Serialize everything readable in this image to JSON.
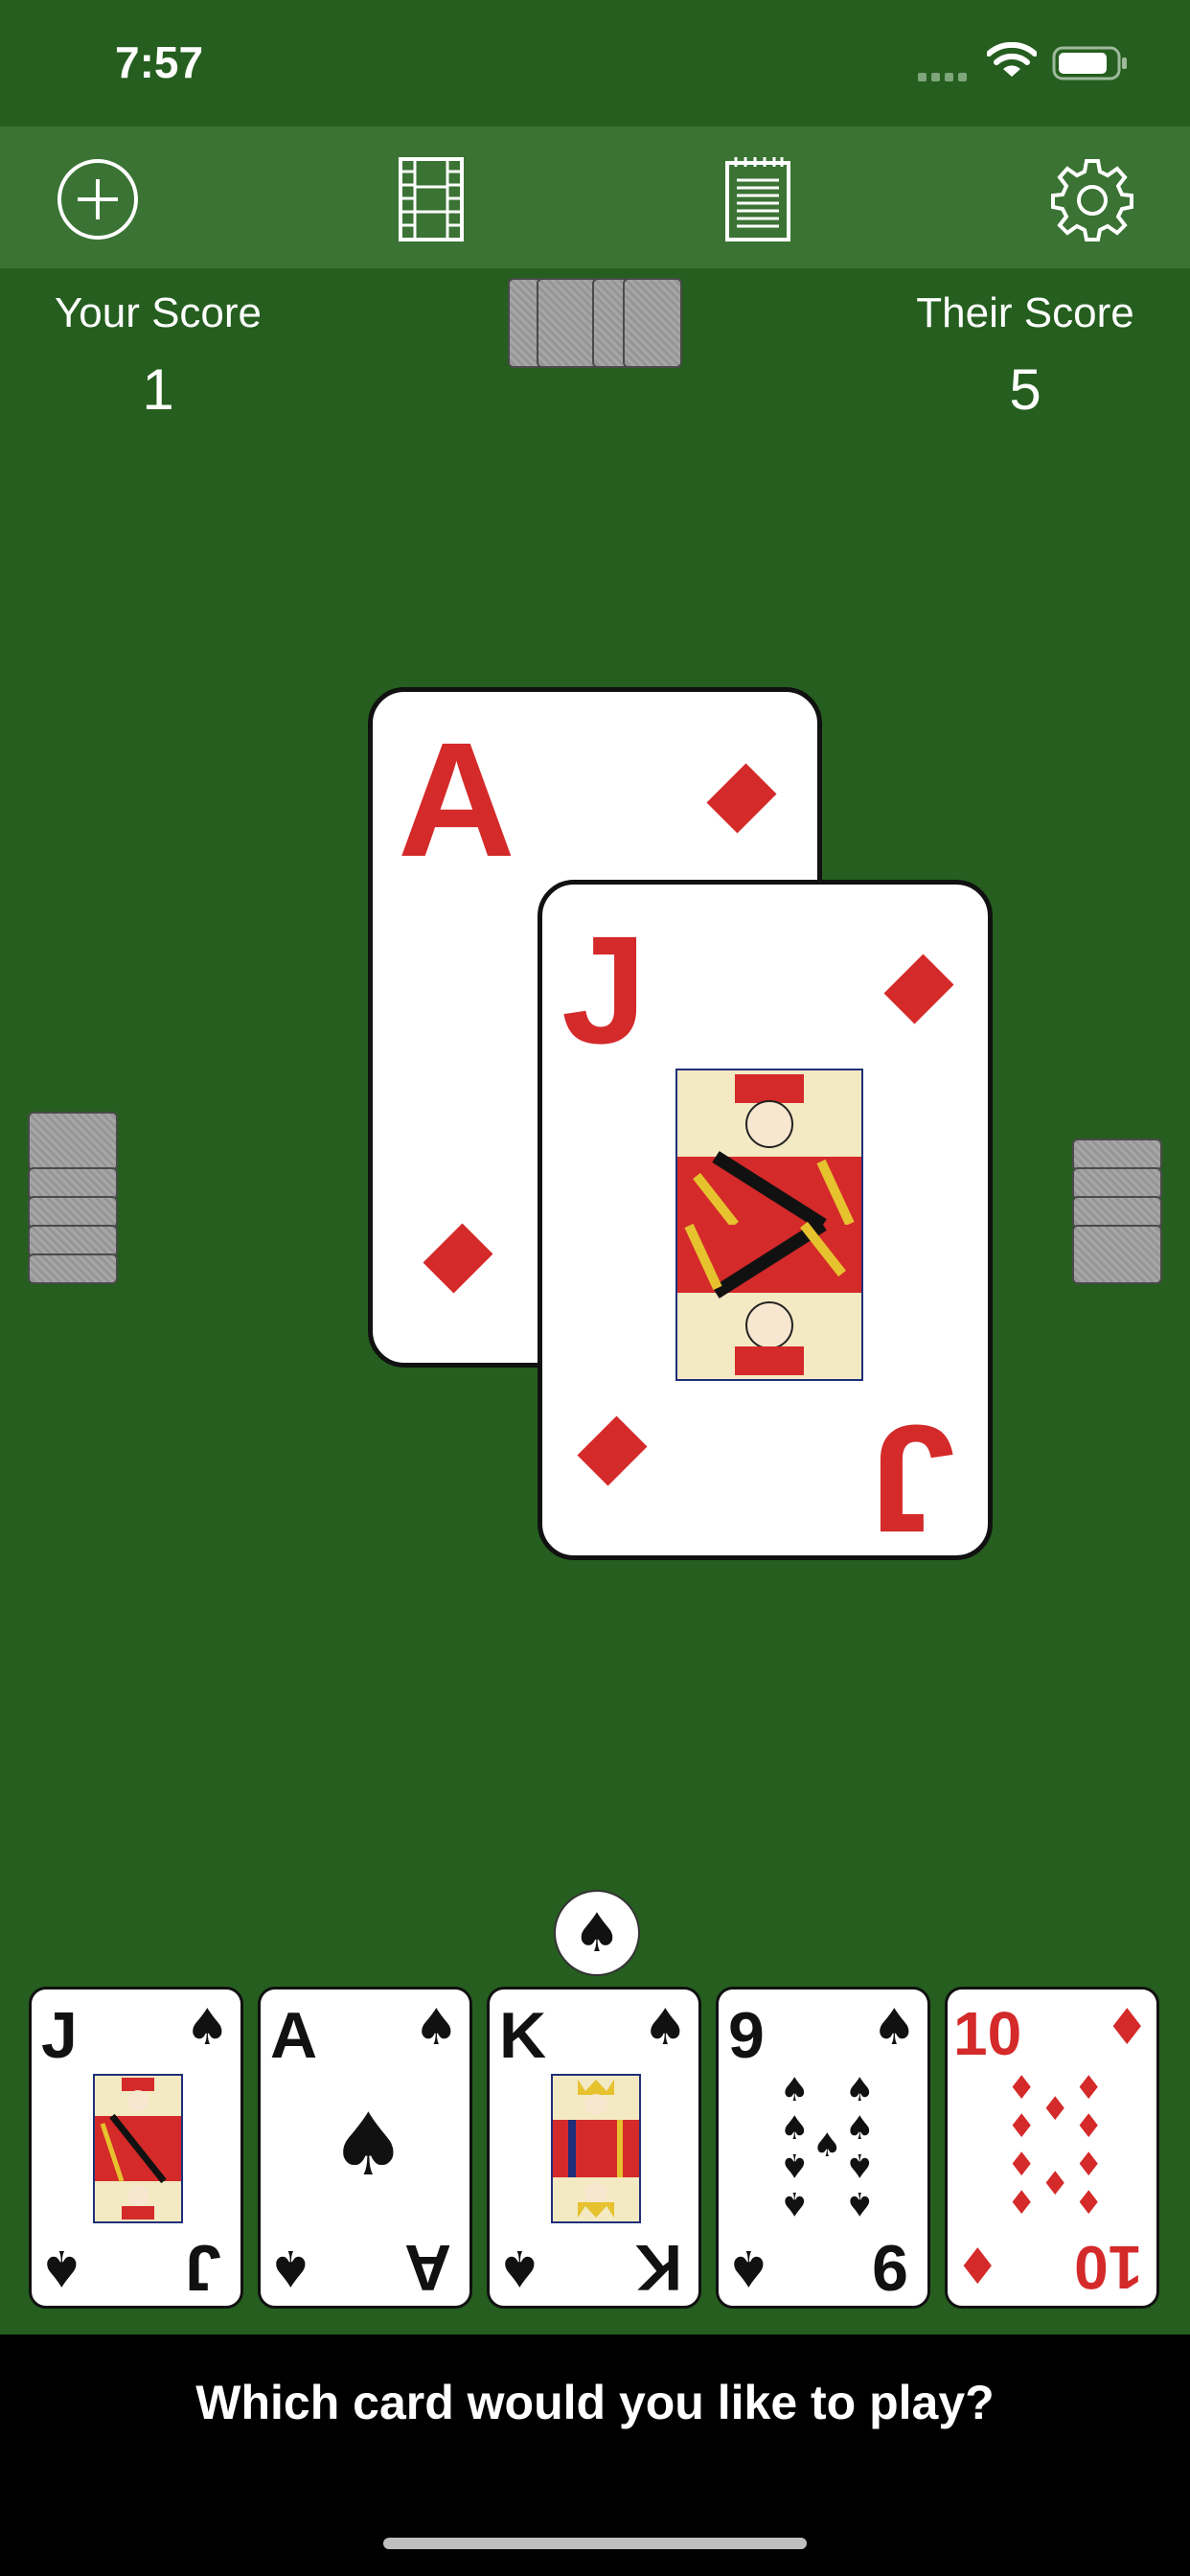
{
  "status_bar": {
    "time": "7:57"
  },
  "toolbar": {
    "icons": [
      "new-game-icon",
      "replay-icon",
      "score-sheet-icon",
      "settings-icon"
    ]
  },
  "scores": {
    "your_label": "Your Score",
    "your_value": "1",
    "their_label": "Their Score",
    "their_value": "5"
  },
  "table": {
    "back_card": {
      "rank": "A",
      "suit": "diamonds"
    },
    "front_card": {
      "rank": "J",
      "suit": "diamonds"
    }
  },
  "trump": {
    "suit": "spades",
    "glyph": "♠"
  },
  "hand": [
    {
      "rank": "J",
      "suit": "spades",
      "glyph": "♠"
    },
    {
      "rank": "A",
      "suit": "spades",
      "glyph": "♠"
    },
    {
      "rank": "K",
      "suit": "spades",
      "glyph": "♠"
    },
    {
      "rank": "9",
      "suit": "spades",
      "glyph": "♠"
    },
    {
      "rank": "10",
      "suit": "diamonds",
      "glyph": "♦"
    }
  ],
  "prompt": {
    "text": "Which card would you like to play?"
  },
  "colors": {
    "felt": "#255e1f",
    "toolbar": "#3a7334",
    "red_suit": "#d42a2a",
    "black_suit": "#111111"
  }
}
